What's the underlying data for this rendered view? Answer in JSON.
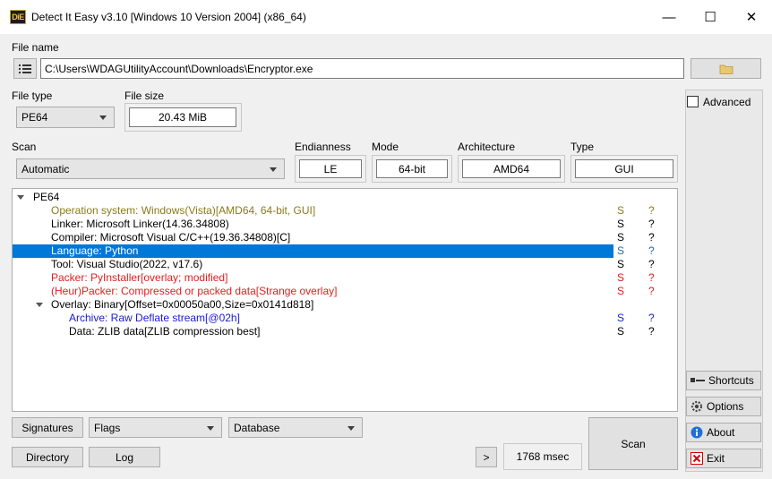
{
  "window": {
    "title": "Detect It Easy v3.10 [Windows 10 Version 2004] (x86_64)",
    "icon_text": "DiE",
    "controls": {
      "minimize": "—",
      "maximize": "☐",
      "close": "✕"
    }
  },
  "file": {
    "label": "File name",
    "path": "C:\\Users\\WDAGUtilityAccount\\Downloads\\Encryptor.exe"
  },
  "filetype": {
    "label": "File type",
    "value": "PE64"
  },
  "filesize": {
    "label": "File size",
    "value": "20.43 MiB"
  },
  "scan": {
    "label": "Scan",
    "value": "Automatic"
  },
  "endianness": {
    "label": "Endianness",
    "value": "LE"
  },
  "mode": {
    "label": "Mode",
    "value": "64-bit"
  },
  "architecture": {
    "label": "Architecture",
    "value": "AMD64"
  },
  "type": {
    "label": "Type",
    "value": "GUI"
  },
  "results": {
    "root": "PE64",
    "rows": [
      {
        "text": "Operation system: Windows(Vista)[AMD64, 64-bit, GUI]",
        "s": "S",
        "q": "?",
        "color": "#8b7a1a"
      },
      {
        "text": "Linker: Microsoft Linker(14.36.34808)",
        "s": "S",
        "q": "?",
        "color": "#000000"
      },
      {
        "text": "Compiler: Microsoft Visual C/C++(19.36.34808)[C]",
        "s": "S",
        "q": "?",
        "color": "#000000"
      },
      {
        "text": "Language: Python",
        "s": "S",
        "q": "?",
        "color": "#ffffff",
        "selected": true
      },
      {
        "text": "Tool: Visual Studio(2022, v17.6)",
        "s": "S",
        "q": "?",
        "color": "#000000"
      },
      {
        "text": "Packer: PyInstaller[overlay; modified]",
        "s": "S",
        "q": "?",
        "color": "#e02020"
      },
      {
        "text": "(Heur)Packer: Compressed or packed data[Strange overlay]",
        "s": "S",
        "q": "?",
        "color": "#e02020"
      },
      {
        "text": "Overlay: Binary[Offset=0x00050a00,Size=0x0141d818]",
        "s": "",
        "q": "",
        "color": "#000000"
      },
      {
        "text": "Archive: Raw Deflate stream[@02h]",
        "s": "S",
        "q": "?",
        "color": "#1a1ad4"
      },
      {
        "text": "Data: ZLIB data[ZLIB compression best]",
        "s": "S",
        "q": "?",
        "color": "#000000"
      }
    ]
  },
  "bottom": {
    "signatures": "Signatures",
    "flags": "Flags",
    "database": "Database",
    "directory": "Directory",
    "log": "Log",
    "more": ">",
    "time": "1768 msec",
    "scan": "Scan"
  },
  "side": {
    "advanced": "Advanced",
    "shortcuts": "Shortcuts",
    "options": "Options",
    "about": "About",
    "exit": "Exit"
  },
  "colors": {
    "selection": "#0078d7",
    "olive": "#8b7a1a",
    "red": "#e02020",
    "blue": "#1a1ad4"
  }
}
